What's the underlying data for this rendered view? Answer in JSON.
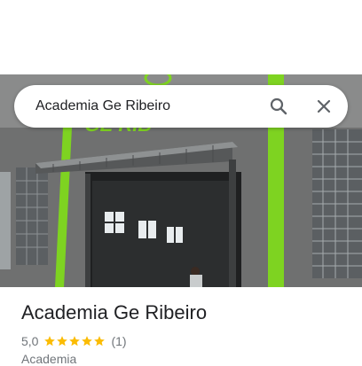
{
  "search": {
    "value": "Academia Ge Ribeiro",
    "search_icon": "search-icon",
    "close_icon": "close-icon"
  },
  "place": {
    "name": "Academia Ge Ribeiro",
    "rating": "5,0",
    "stars": 5,
    "review_count": "(1)",
    "category": "Academia"
  },
  "colors": {
    "star": "#fbbc04",
    "accent_green": "#7ed321",
    "wall": "#6f7070"
  }
}
